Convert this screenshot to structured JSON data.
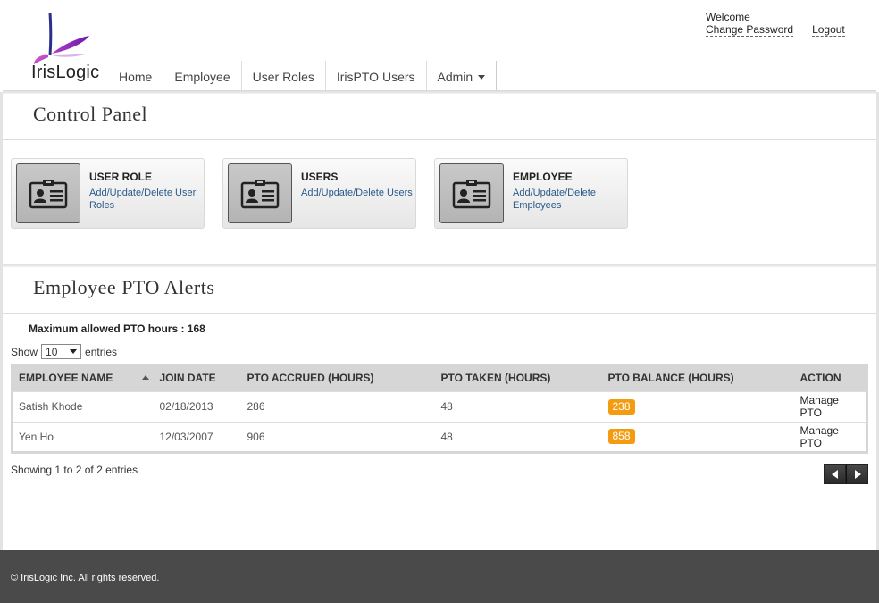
{
  "header": {
    "logo_text": "IrisLogic",
    "welcome": "Welcome",
    "change_password": "Change Password",
    "logout": "Logout",
    "nav": [
      {
        "label": "Home"
      },
      {
        "label": "Employee"
      },
      {
        "label": "User Roles"
      },
      {
        "label": "IrisPTO Users"
      },
      {
        "label": "Admin"
      }
    ]
  },
  "control_panel": {
    "title": "Control Panel",
    "cards": [
      {
        "title": "USER ROLE",
        "desc": "Add/Update/Delete User Roles",
        "icon": "id-card-icon"
      },
      {
        "title": "USERS",
        "desc": "Add/Update/Delete Users",
        "icon": "id-card-icon"
      },
      {
        "title": "EMPLOYEE",
        "desc": "Add/Update/Delete Employees",
        "icon": "id-card-icon"
      }
    ]
  },
  "pto_alerts": {
    "title": "Employee PTO Alerts",
    "max_label": "Maximum allowed PTO hours : 168",
    "show_label": "Show",
    "page_size": "10",
    "entries_label": "entries",
    "columns": [
      "EMPLOYEE NAME",
      "JOIN DATE",
      "PTO ACCRUED (HOURS)",
      "PTO TAKEN (HOURS)",
      "PTO BALANCE (HOURS)",
      "ACTION"
    ],
    "rows": [
      {
        "name": "Satish Khode",
        "join_date": "02/18/2013",
        "accrued": "286",
        "taken": "48",
        "balance": "238",
        "action": "Manage PTO"
      },
      {
        "name": "Yen Ho",
        "join_date": "12/03/2007",
        "accrued": "906",
        "taken": "48",
        "balance": "858",
        "action": "Manage PTO"
      }
    ],
    "showing": "Showing 1 to 2 of 2 entries"
  },
  "footer": {
    "copyright": "© IrisLogic Inc. All rights reserved."
  },
  "colors": {
    "badge": "#f39c12",
    "footer_bg": "#4a4a4a",
    "table_header": "#d6d6d6",
    "link": "#2a5a8a"
  }
}
